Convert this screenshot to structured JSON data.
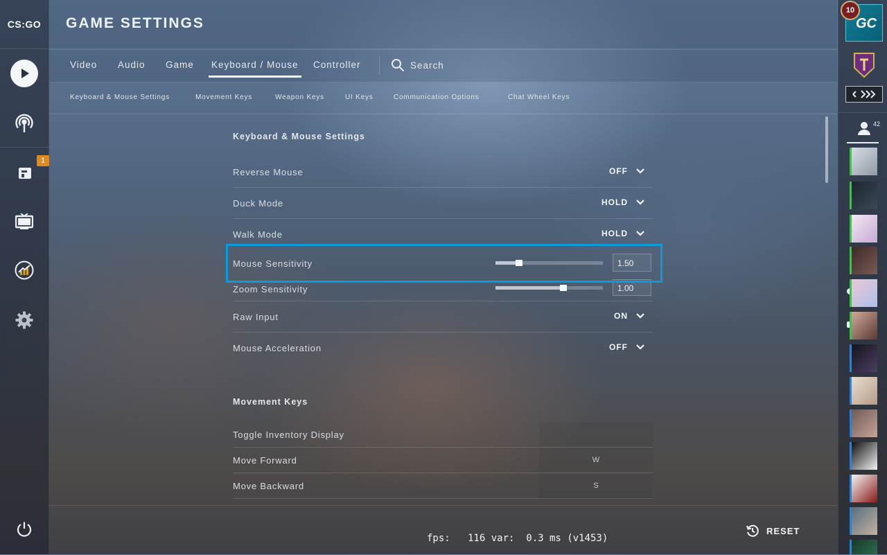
{
  "app": {
    "logo": "CS:GO",
    "title": "GAME SETTINGS"
  },
  "leftnav": {
    "items": [
      {
        "name": "play",
        "icon": "play-icon"
      },
      {
        "name": "watch",
        "icon": "broadcast-icon"
      },
      {
        "name": "inventory",
        "icon": "inventory-icon",
        "badge": "1"
      },
      {
        "name": "tv",
        "icon": "tv-icon"
      },
      {
        "name": "stats",
        "icon": "stats-icon"
      },
      {
        "name": "settings",
        "icon": "gear-icon"
      }
    ],
    "power_icon": "power-icon"
  },
  "tabs": {
    "items": [
      "Video",
      "Audio",
      "Game",
      "Keyboard / Mouse",
      "Controller"
    ],
    "active": "Keyboard / Mouse",
    "search_label": "Search"
  },
  "subtabs": [
    "Keyboard & Mouse Settings",
    "Movement Keys",
    "Weapon Keys",
    "UI Keys",
    "Communication Options",
    "Chat Wheel Keys"
  ],
  "kbm": {
    "section_title": "Keyboard & Mouse Settings",
    "reverse_mouse": {
      "label": "Reverse Mouse",
      "value": "OFF"
    },
    "duck_mode": {
      "label": "Duck Mode",
      "value": "HOLD"
    },
    "walk_mode": {
      "label": "Walk Mode",
      "value": "HOLD"
    },
    "mouse_sensitivity": {
      "label": "Mouse Sensitivity",
      "value": "1.50",
      "slider_fraction": 0.22
    },
    "zoom_sensitivity": {
      "label": "Zoom Sensitivity",
      "value": "1.00",
      "slider_fraction": 0.63
    },
    "raw_input": {
      "label": "Raw Input",
      "value": "ON"
    },
    "mouse_acceleration": {
      "label": "Mouse Acceleration",
      "value": "OFF"
    }
  },
  "movement": {
    "section_title": "Movement Keys",
    "toggle_inventory": {
      "label": "Toggle Inventory Display",
      "key": ""
    },
    "move_forward": {
      "label": "Move Forward",
      "key": "W"
    },
    "move_backward": {
      "label": "Move Backward",
      "key": "S"
    }
  },
  "footer": {
    "fps_text": "fps:   116 var:  0.3 ms (v1453)",
    "reset_label": "RESET"
  },
  "rightpanel": {
    "level": "10",
    "rank_text": "GC",
    "friends_count": "42"
  },
  "colors": {
    "highlight": "#0a9bdc",
    "badge": "#e38a1f",
    "online": "#4db85a",
    "away": "#3a7fc2"
  }
}
